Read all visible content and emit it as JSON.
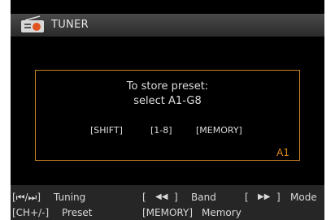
{
  "header": {
    "title": "TUNER",
    "icon": "radio-icon"
  },
  "dialog": {
    "line1": "To store preset:",
    "line2": "select  A1-G8",
    "keys": [
      "[SHIFT]",
      "[1-8]",
      "[MEMORY]"
    ],
    "preset_value": "A1"
  },
  "footer": {
    "tuning_key": "[⏮/⏭]",
    "tuning_label": "Tuning",
    "band_key_open": "[",
    "band_key_icon": "◀◀",
    "band_key_close": "]",
    "band_label": "Band",
    "mode_key_open": "[",
    "mode_key_icon": "▶▶",
    "mode_key_close": "]",
    "mode_label": "Mode",
    "preset_key": "[CH+/-]",
    "preset_label": "Preset",
    "memory_key": "[MEMORY]",
    "memory_label": "Memory"
  },
  "colors": {
    "accent": "#e08a1c",
    "background": "#000000",
    "header": "#3a3a3a"
  }
}
